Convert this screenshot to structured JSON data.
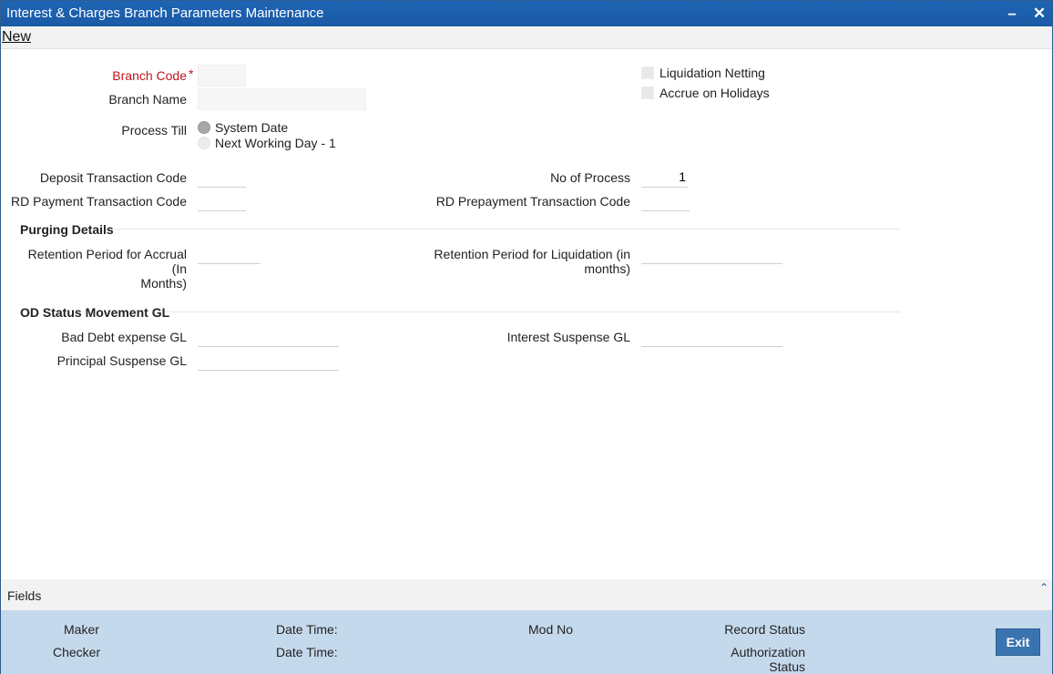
{
  "window": {
    "title": "Interest & Charges Branch Parameters Maintenance",
    "minimize_icon": "minimize-icon",
    "close_icon": "close-icon"
  },
  "menu": {
    "new_label": "New"
  },
  "form": {
    "branch_code": {
      "label": "Branch Code",
      "required_mark": "*",
      "value": ""
    },
    "branch_name": {
      "label": "Branch Name",
      "value": ""
    },
    "process_till": {
      "label": "Process Till",
      "options": [
        "System Date",
        "Next Working Day - 1"
      ],
      "selected": "System Date"
    },
    "liquidation_netting": {
      "label": "Liquidation Netting",
      "checked": false
    },
    "accrue_on_holidays": {
      "label": "Accrue on Holidays",
      "checked": false
    },
    "deposit_txn_code": {
      "label": "Deposit Transaction Code",
      "value": ""
    },
    "no_of_process": {
      "label": "No of Process",
      "value": "1"
    },
    "rd_payment_txn_code": {
      "label": "RD Payment Transaction Code",
      "value": ""
    },
    "rd_prepayment_txn_code": {
      "label": "RD Prepayment Transaction Code",
      "value": ""
    },
    "purging_details": {
      "heading": "Purging Details",
      "retention_accrual": {
        "label_line1": "Retention Period for Accrual (In",
        "label_line2": "Months)",
        "value": ""
      },
      "retention_liquidation": {
        "label_line1": "Retention Period for Liquidation (in",
        "label_line2": "months)",
        "value": ""
      }
    },
    "od_status": {
      "heading": "OD Status Movement GL",
      "bad_debt_gl": {
        "label": "Bad Debt expense GL",
        "value": ""
      },
      "interest_suspense_gl": {
        "label": "Interest Suspense GL",
        "value": ""
      },
      "principal_suspense_gl": {
        "label": "Principal Suspense GL",
        "value": ""
      }
    }
  },
  "fields_bar": {
    "label": "Fields",
    "chevron_icon": "chevron-up-icon"
  },
  "footer": {
    "maker": "Maker",
    "checker": "Checker",
    "date_time_1": "Date Time:",
    "date_time_2": "Date Time:",
    "mod_no": "Mod No",
    "record_status": "Record Status",
    "authorization_status_line1": "Authorization",
    "authorization_status_line2": "Status",
    "exit_label": "Exit"
  },
  "colors": {
    "title_bar": "#1e64b4",
    "footer": "#c5d9ec",
    "required": "#c0141c",
    "exit_button": "#3a74b0"
  }
}
